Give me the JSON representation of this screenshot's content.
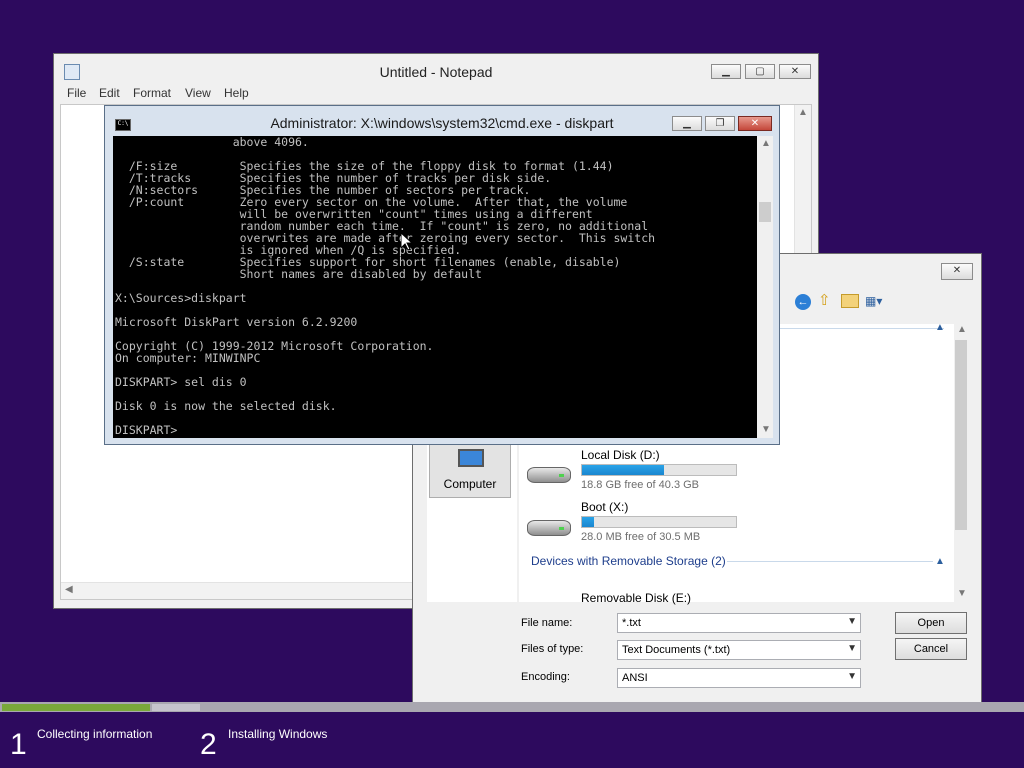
{
  "notepad": {
    "title": "Untitled - Notepad",
    "menu": [
      "File",
      "Edit",
      "Format",
      "View",
      "Help"
    ]
  },
  "cmd": {
    "title": "Administrator: X:\\windows\\system32\\cmd.exe - diskpart",
    "lines": [
      "                 above 4096.",
      "",
      "  /F:size         Specifies the size of the floppy disk to format (1.44)",
      "  /T:tracks       Specifies the number of tracks per disk side.",
      "  /N:sectors      Specifies the number of sectors per track.",
      "  /P:count        Zero every sector on the volume.  After that, the volume",
      "                  will be overwritten \"count\" times using a different",
      "                  random number each time.  If \"count\" is zero, no additional",
      "                  overwrites are made after zeroing every sector.  This switch",
      "                  is ignored when /Q is specified.",
      "  /S:state        Specifies support for short filenames (enable, disable)",
      "                  Short names are disabled by default",
      "",
      "X:\\Sources>diskpart",
      "",
      "Microsoft DiskPart version 6.2.9200",
      "",
      "Copyright (C) 1999-2012 Microsoft Corporation.",
      "On computer: MINWINPC",
      "",
      "DISKPART> sel dis 0",
      "",
      "Disk 0 is now the selected disk.",
      "",
      "DISKPART>"
    ]
  },
  "open_dialog": {
    "nav_item": "Computer",
    "drives": [
      {
        "name": "Local Disk (D:)",
        "free": "18.8 GB free of 40.3 GB",
        "used_fraction": 0.53
      },
      {
        "name": "Boot (X:)",
        "free": "28.0 MB free of 30.5 MB",
        "used_fraction": 0.08
      }
    ],
    "removable_group": "Devices with Removable Storage (2)",
    "removable_partial": "Removable Disk (E:)",
    "filename_label": "File name:",
    "filename_value": "*.txt",
    "filetype_label": "Files of type:",
    "filetype_value": "Text Documents (*.txt)",
    "encoding_label": "Encoding:",
    "encoding_value": "ANSI",
    "open_button": "Open",
    "cancel_button": "Cancel"
  },
  "setup": {
    "steps": [
      {
        "num": "1",
        "label": "Collecting information"
      },
      {
        "num": "2",
        "label": "Installing Windows"
      }
    ]
  }
}
